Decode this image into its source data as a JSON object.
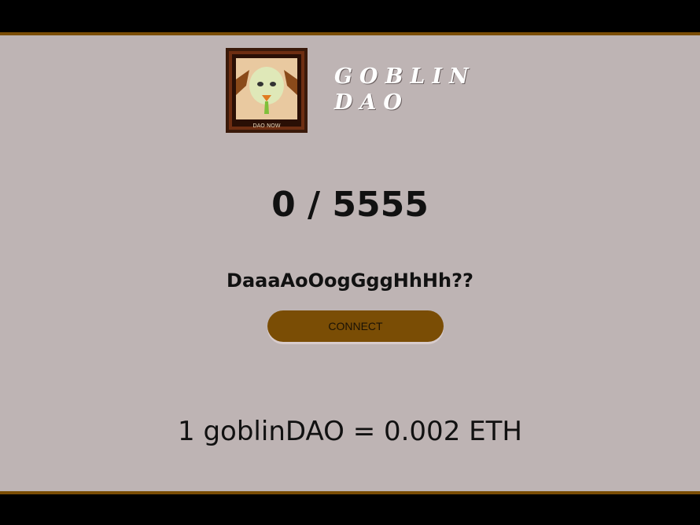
{
  "header": {
    "logo_icon": "goblin-portrait-frame-icon",
    "logo_caption": "DAO NOW",
    "brand_line1": "GOBLIN",
    "brand_line2": "DAO"
  },
  "mint": {
    "counter": "0 / 5555",
    "tagline": "DaaaAoOogGggHhHh??",
    "connect_label": "CONNECT",
    "price": "1 goblinDAO = 0.002 ETH"
  },
  "colors": {
    "background": "#beb4b4",
    "accent": "#7a4d05",
    "bars": "#000000"
  }
}
